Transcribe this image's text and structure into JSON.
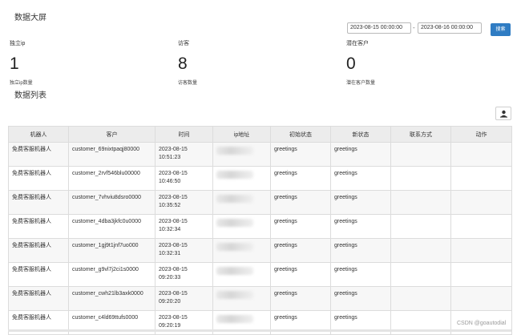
{
  "page_title": "数据大屏",
  "filters": {
    "start_date": "2023-08-15 00:00:00",
    "separator": "-",
    "end_date": "2023-08-16 00:00:00",
    "search_label": "搜索"
  },
  "stats": [
    {
      "label": "独立ip",
      "value": "1",
      "sub": "独立ip数量"
    },
    {
      "label": "访客",
      "value": "8",
      "sub": "访客数量"
    },
    {
      "label": "潜在客户",
      "value": "0",
      "sub": "潜在客户数量"
    }
  ],
  "list_title": "数据列表",
  "export_icon": "user-export-icon",
  "columns": [
    "机器人",
    "客户",
    "时间",
    "ip地址",
    "初始状态",
    "新状态",
    "联系方式",
    "动作"
  ],
  "rows": [
    {
      "robot": "免费客服机器人",
      "customer": "customer_69nixtpaqj80000",
      "date": "2023-08-15",
      "time": "10:51:23",
      "initial": "greetings",
      "new": "greetings",
      "contact": "",
      "action": ""
    },
    {
      "robot": "免费客服机器人",
      "customer": "customer_2rvf546blu00000",
      "date": "2023-08-15",
      "time": "10:46:50",
      "initial": "greetings",
      "new": "greetings",
      "contact": "",
      "action": ""
    },
    {
      "robot": "免费客服机器人",
      "customer": "customer_7vhviu8dsro0000",
      "date": "2023-08-15",
      "time": "10:35:52",
      "initial": "greetings",
      "new": "greetings",
      "contact": "",
      "action": ""
    },
    {
      "robot": "免费客服机器人",
      "customer": "customer_4dba3jkfc0u0000",
      "date": "2023-08-15",
      "time": "10:32:34",
      "initial": "greetings",
      "new": "greetings",
      "contact": "",
      "action": ""
    },
    {
      "robot": "免费客服机器人",
      "customer": "customer_1gj9t1jnf7uo000",
      "date": "2023-08-15",
      "time": "10:32:31",
      "initial": "greetings",
      "new": "greetings",
      "contact": "",
      "action": ""
    },
    {
      "robot": "免费客服机器人",
      "customer": "customer_g9vl7j2ci1s0000",
      "date": "2023-08-15",
      "time": "09:20:33",
      "initial": "greetings",
      "new": "greetings",
      "contact": "",
      "action": ""
    },
    {
      "robot": "免费客服机器人",
      "customer": "customer_cwh21lb3axk0000",
      "date": "2023-08-15",
      "time": "09:20:20",
      "initial": "greetings",
      "new": "greetings",
      "contact": "",
      "action": ""
    },
    {
      "robot": "免费客服机器人",
      "customer": "customer_c4ld69ttufs0000",
      "date": "2023-08-15",
      "time": "09:20:19",
      "initial": "greetings",
      "new": "greetings",
      "contact": "",
      "action": ""
    }
  ],
  "watermark": "CSDN @goautodial",
  "colors": {
    "accent": "#2f7cc3",
    "header_bg": "#ececec",
    "border": "#dcdcdc"
  }
}
